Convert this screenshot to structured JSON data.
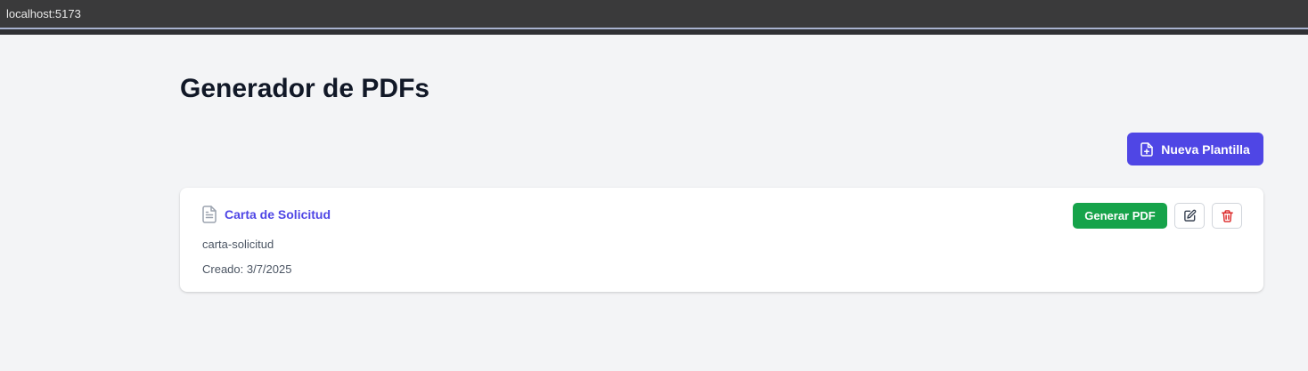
{
  "browser": {
    "url": "localhost:5173"
  },
  "page": {
    "title": "Generador de PDFs",
    "new_template_label": "Nueva Plantilla"
  },
  "templates": [
    {
      "name": "Carta de Solicitud",
      "slug": "carta-solicitud",
      "created": "Creado: 3/7/2025",
      "generate_label": "Generar PDF",
      "icons": [
        "file-text-icon",
        "edit-icon",
        "trash-icon"
      ]
    }
  ],
  "colors": {
    "primary": "#4f46e5",
    "success": "#16a34a",
    "danger": "#dc2626",
    "background": "#f3f4f6"
  }
}
